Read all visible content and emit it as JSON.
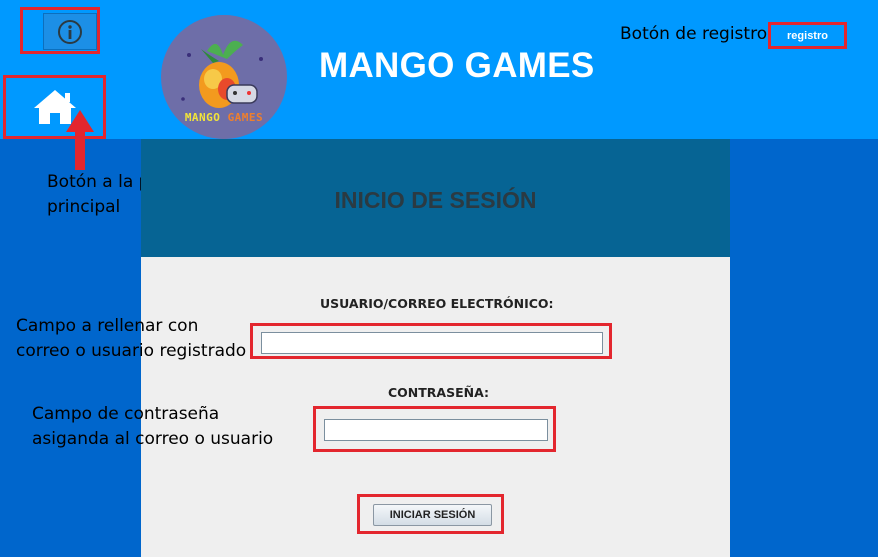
{
  "header": {
    "brand_title": "MANGO GAMES",
    "logo_text_1": "MANGO",
    "logo_text_2": "GAMES",
    "register_annotation": "Botón de registro",
    "register_button": "registro",
    "info_icon": "info-icon",
    "home_icon": "home-icon"
  },
  "annotations": {
    "home_line1": "Botón a la página",
    "home_line2": "principal",
    "user_line1": "Campo a rellenar con",
    "user_line2": "correo o usuario registrado",
    "pass_line1": "Campo de contraseña",
    "pass_line2": "asiganda al correo o usuario"
  },
  "login": {
    "title": "INICIO DE SESIÓN",
    "user_label": "USUARIO/CORREO ELECTRÓNICO:",
    "user_value": "",
    "password_label": "CONTRASEÑA:",
    "password_value": "",
    "submit_label": "INICIAR SESIÓN"
  },
  "colors": {
    "header_bg": "#0099ff",
    "page_bg": "#0066cc",
    "title_band": "#066494",
    "panel_bg": "#efefef",
    "annotation_red": "#e3262e"
  }
}
